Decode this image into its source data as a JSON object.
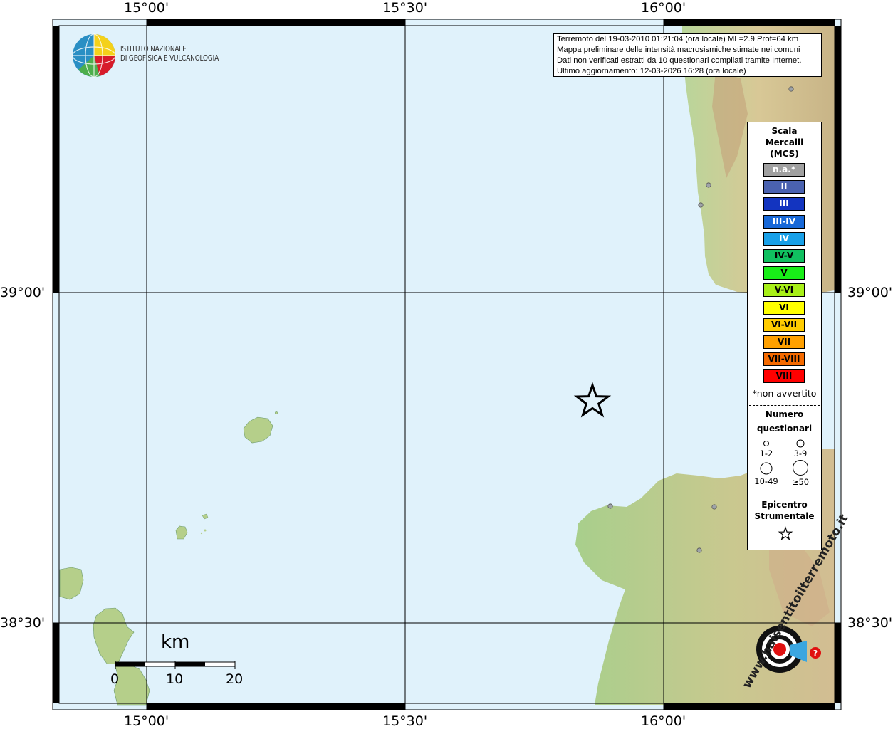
{
  "axes": {
    "top_lon": [
      "15°00'",
      "15°30'",
      "16°00'"
    ],
    "bottom_lon": [
      "15°00'",
      "15°30'",
      "16°00'"
    ],
    "left_lat": [
      "39°00'",
      "38°30'"
    ],
    "right_lat": [
      "39°00'",
      "38°30'"
    ]
  },
  "institute": {
    "line1": "ISTITUTO NAZIONALE",
    "line2": "DI GEOFISICA E VULCANOLOGIA"
  },
  "info": {
    "line1": "Terremoto del 19-03-2010 01:21:04 (ora locale) ML=2.9 Prof=64 km",
    "line2": "Mappa preliminare delle intensità macrosismiche stimate nei comuni",
    "line3": "Dati non verificati estratti da 10 questionari compilati tramite Internet.",
    "line4": "Ultimo aggiornamento: 12-03-2026 16:28 (ora locale)"
  },
  "legend": {
    "title_line1": "Scala",
    "title_line2": "Mercalli",
    "title_line3": "(MCS)",
    "scale": [
      {
        "label": "n.a.*",
        "color": "#a0a0a0",
        "text_color": "#ffffff"
      },
      {
        "label": "II",
        "color": "#4a62b0",
        "text_color": "#ffffff"
      },
      {
        "label": "III",
        "color": "#1334c0",
        "text_color": "#ffffff"
      },
      {
        "label": "III-IV",
        "color": "#1768d8",
        "text_color": "#ffffff"
      },
      {
        "label": "IV",
        "color": "#18a0e8",
        "text_color": "#ffffff"
      },
      {
        "label": "IV-V",
        "color": "#10c060",
        "text_color": "#000000"
      },
      {
        "label": "V",
        "color": "#18ee18",
        "text_color": "#000000"
      },
      {
        "label": "V-VI",
        "color": "#a8f018",
        "text_color": "#000000"
      },
      {
        "label": "VI",
        "color": "#ffff00",
        "text_color": "#000000"
      },
      {
        "label": "VI-VII",
        "color": "#ffcc00",
        "text_color": "#000000"
      },
      {
        "label": "VII",
        "color": "#ffa000",
        "text_color": "#000000"
      },
      {
        "label": "VII-VIII",
        "color": "#f56a00",
        "text_color": "#000000"
      },
      {
        "label": "VIII",
        "color": "#ff0000",
        "text_color": "#000000"
      }
    ],
    "not_felt_note": "*non avvertito",
    "questionnaires_line1": "Numero",
    "questionnaires_line2": "questionari",
    "circle_labels": [
      "1-2",
      "3-9",
      "10-49",
      "≥50"
    ],
    "epicenter_line1": "Epicentro",
    "epicenter_line2": "Strumentale"
  },
  "scalebar": {
    "unit": "km",
    "ticks": [
      "0",
      "10",
      "20"
    ]
  },
  "colors": {
    "sea": "#e0f2fb",
    "land": "#a9cf8a",
    "grid": "#000000",
    "frame": "#000000"
  },
  "hsit_logo": {
    "text": "www.haisentitoilterremoto.it"
  }
}
